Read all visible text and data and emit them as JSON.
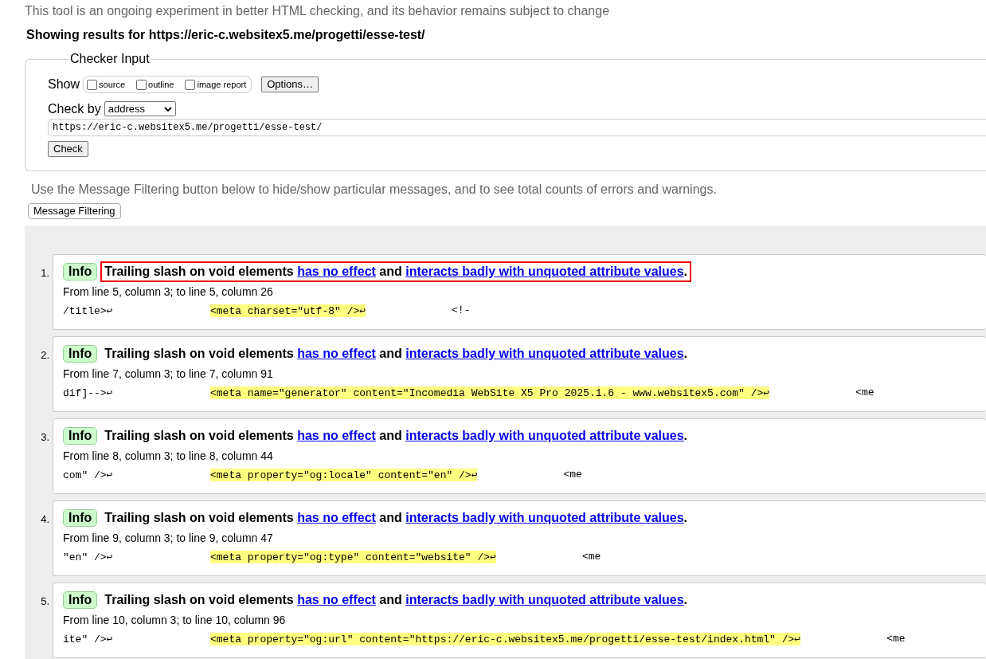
{
  "intro": "This tool is an ongoing experiment in better HTML checking, and its behavior remains subject to change",
  "results_heading": "Showing results for https://eric-c.websitex5.me/progetti/esse-test/",
  "checker_input": {
    "legend": "Checker Input",
    "show_label": "Show",
    "show_options": [
      {
        "label": "source",
        "checked": false
      },
      {
        "label": "outline",
        "checked": false
      },
      {
        "label": "image report",
        "checked": false
      }
    ],
    "options_button": "Options…",
    "check_by_label": "Check by",
    "check_by_value": "address",
    "address": "https://eric-c.websitex5.me/progetti/esse-test/",
    "check_button": "Check"
  },
  "filter_note": "Use the Message Filtering button below to hide/show particular messages, and to see total counts of errors and warnings.",
  "filter_button": "Message Filtering",
  "messages": [
    {
      "number": "1.",
      "type": "Info",
      "outlined": true,
      "text_parts": [
        {
          "kind": "text",
          "text": "Trailing slash on void elements "
        },
        {
          "kind": "link",
          "text": "has no effect"
        },
        {
          "kind": "text",
          "text": " and "
        },
        {
          "kind": "link",
          "text": "interacts badly with unquoted attribute values"
        },
        {
          "kind": "text",
          "text": "."
        }
      ],
      "location": "From line 5, column 3; to line 5, column 26",
      "extract_before": "/title>↩",
      "extract_highlight": "<meta charset=\"utf-8\" />↩",
      "extract_after": "<!-"
    },
    {
      "number": "2.",
      "type": "Info",
      "outlined": false,
      "text_parts": [
        {
          "kind": "text",
          "text": "Trailing slash on void elements "
        },
        {
          "kind": "link",
          "text": "has no effect"
        },
        {
          "kind": "text",
          "text": " and "
        },
        {
          "kind": "link",
          "text": "interacts badly with unquoted attribute values"
        },
        {
          "kind": "text",
          "text": "."
        }
      ],
      "location": "From line 7, column 3; to line 7, column 91",
      "extract_before": "dif]-->↩",
      "extract_highlight": "<meta name=\"generator\" content=\"Incomedia WebSite X5 Pro 2025.1.6 - www.websitex5.com\" />↩",
      "extract_after": "<me"
    },
    {
      "number": "3.",
      "type": "Info",
      "outlined": false,
      "text_parts": [
        {
          "kind": "text",
          "text": "Trailing slash on void elements "
        },
        {
          "kind": "link",
          "text": "has no effect"
        },
        {
          "kind": "text",
          "text": " and "
        },
        {
          "kind": "link",
          "text": "interacts badly with unquoted attribute values"
        },
        {
          "kind": "text",
          "text": "."
        }
      ],
      "location": "From line 8, column 3; to line 8, column 44",
      "extract_before": "com\" />↩",
      "extract_highlight": "<meta property=\"og:locale\" content=\"en\" />↩",
      "extract_after": "<me"
    },
    {
      "number": "4.",
      "type": "Info",
      "outlined": false,
      "text_parts": [
        {
          "kind": "text",
          "text": "Trailing slash on void elements "
        },
        {
          "kind": "link",
          "text": "has no effect"
        },
        {
          "kind": "text",
          "text": " and "
        },
        {
          "kind": "link",
          "text": "interacts badly with unquoted attribute values"
        },
        {
          "kind": "text",
          "text": "."
        }
      ],
      "location": "From line 9, column 3; to line 9, column 47",
      "extract_before": "\"en\" />↩",
      "extract_highlight": "<meta property=\"og:type\" content=\"website\" />↩",
      "extract_after": "<me"
    },
    {
      "number": "5.",
      "type": "Info",
      "outlined": false,
      "text_parts": [
        {
          "kind": "text",
          "text": "Trailing slash on void elements "
        },
        {
          "kind": "link",
          "text": "has no effect"
        },
        {
          "kind": "text",
          "text": " and "
        },
        {
          "kind": "link",
          "text": "interacts badly with unquoted attribute values"
        },
        {
          "kind": "text",
          "text": "."
        }
      ],
      "location": "From line 10, column 3; to line 10, column 96",
      "extract_before": "ite\" />↩",
      "extract_highlight": "<meta property=\"og:url\" content=\"https://eric-c.websitex5.me/progetti/esse-test/index.html\" />↩",
      "extract_after": "<me"
    }
  ]
}
